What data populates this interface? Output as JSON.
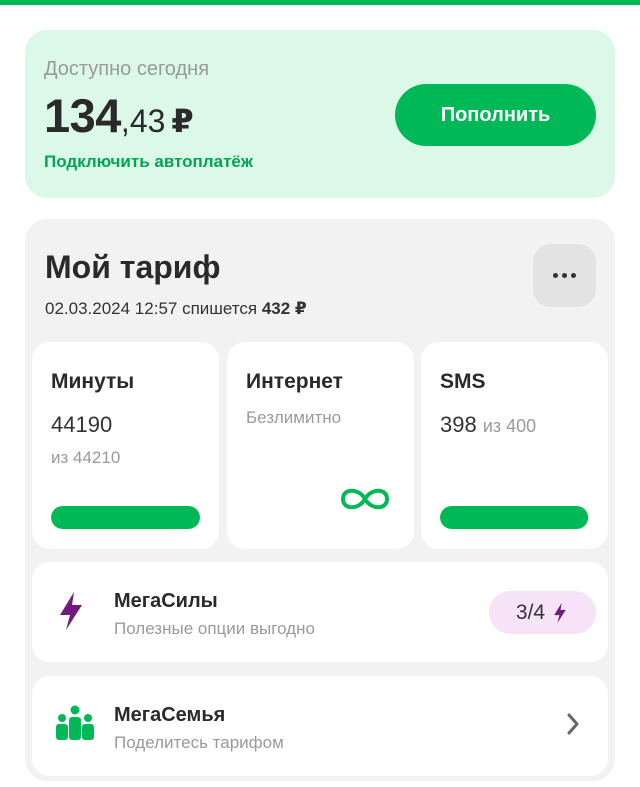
{
  "balance": {
    "label": "Доступно сегодня",
    "amount_int": "134",
    "amount_frac": ",43",
    "currency": "₽",
    "autopay_link": "Подключить автоплатёж",
    "topup_label": "Пополнить"
  },
  "tariff": {
    "title": "Мой тариф",
    "charge_text": "02.03.2024 12:57 спишется",
    "charge_amount": "432 ₽",
    "menu_icon": "more-horizontal-icon"
  },
  "tiles": {
    "minutes": {
      "title": "Минуты",
      "value": "44190",
      "sub": "из 44210",
      "remaining_fraction": 0.9995
    },
    "internet": {
      "title": "Интернет",
      "note": "Безлимитно",
      "icon": "infinity-icon"
    },
    "sms": {
      "title": "SMS",
      "value": "398",
      "of": "из 400",
      "remaining_fraction": 0.995
    }
  },
  "megasily": {
    "title": "МегаСилы",
    "subtitle": "Полезные опции выгодно",
    "badge": "3/4",
    "icon": "lightning-icon"
  },
  "megasemya": {
    "title": "МегаСемья",
    "subtitle": "Поделитесь тарифом",
    "icon": "family-icon"
  },
  "colors": {
    "brand_green": "#00b956",
    "balance_bg": "#dcf8e9",
    "panel_bg": "#f2f2f2",
    "purple": "#731982",
    "badge_bg": "#f7e3f7"
  }
}
